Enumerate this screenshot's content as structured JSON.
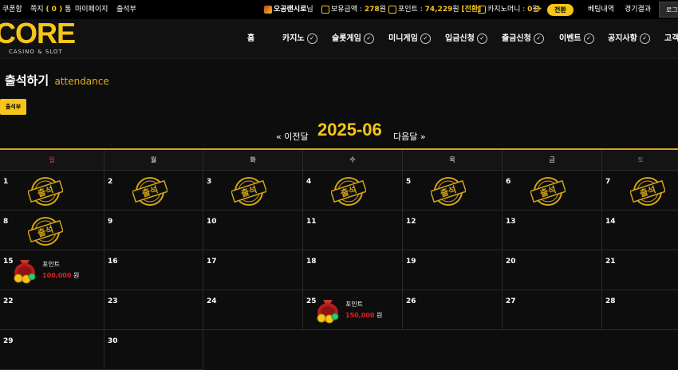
{
  "topbar": {
    "coupon": "쿠폰함",
    "notes_label": "쪽지",
    "notes_count": "( 0 )",
    "notes_suffix": "통",
    "mypage": "마이페이지",
    "attendance": "출석부",
    "username": "오공랜시로",
    "user_suffix": "님",
    "balance_label": "보유금액 :",
    "balance_value": "278",
    "balance_unit": "원",
    "points_label": "포인트 :",
    "points_value": "74,229",
    "points_unit": "원",
    "points_convert": "[전환]",
    "casino_money_label": "카지노머니 :",
    "casino_money_value": "0",
    "casino_money_unit": "원",
    "convert_btn": "전환",
    "bet_history": "베팅내역",
    "game_results": "경기결과",
    "login": "로그"
  },
  "logo": {
    "word": "CORE",
    "sub": "CASINO & SLOT"
  },
  "nav": [
    "홈",
    "카지노",
    "슬롯게임",
    "미니게임",
    "입금신청",
    "출금신청",
    "이벤트",
    "공지사항",
    "고객"
  ],
  "page": {
    "title": "출석하기",
    "title_en": "attendance",
    "attend_button": "출석부",
    "prev": "« 이전달",
    "month": "2025-06",
    "next": "다음달 »"
  },
  "calendar": {
    "weekdays": [
      "일",
      "월",
      "화",
      "수",
      "목",
      "금",
      "토"
    ],
    "weekday_colors": [
      "#ff3b3b",
      "#ffffff",
      "#ffffff",
      "#ffffff",
      "#ffffff",
      "#ffffff",
      "#3b8bff"
    ],
    "stamp_text": "출석",
    "stamped_days": [
      1,
      2,
      3,
      4,
      5,
      6,
      7,
      8
    ],
    "rewards": [
      {
        "day": 15,
        "label": "포인트",
        "amount": "100,000",
        "unit": "원"
      },
      {
        "day": 25,
        "label": "포인트",
        "amount": "150,000",
        "unit": "원"
      }
    ],
    "days": [
      1,
      2,
      3,
      4,
      5,
      6,
      7,
      8,
      9,
      10,
      11,
      12,
      13,
      14,
      15,
      16,
      17,
      18,
      19,
      20,
      21,
      22,
      23,
      24,
      25,
      26,
      27,
      28,
      29,
      30
    ]
  },
  "colors": {
    "accent": "#f5c518",
    "reward_amount": "#e02020",
    "sunday": "#ff3b3b",
    "saturday": "#3b8bff"
  }
}
